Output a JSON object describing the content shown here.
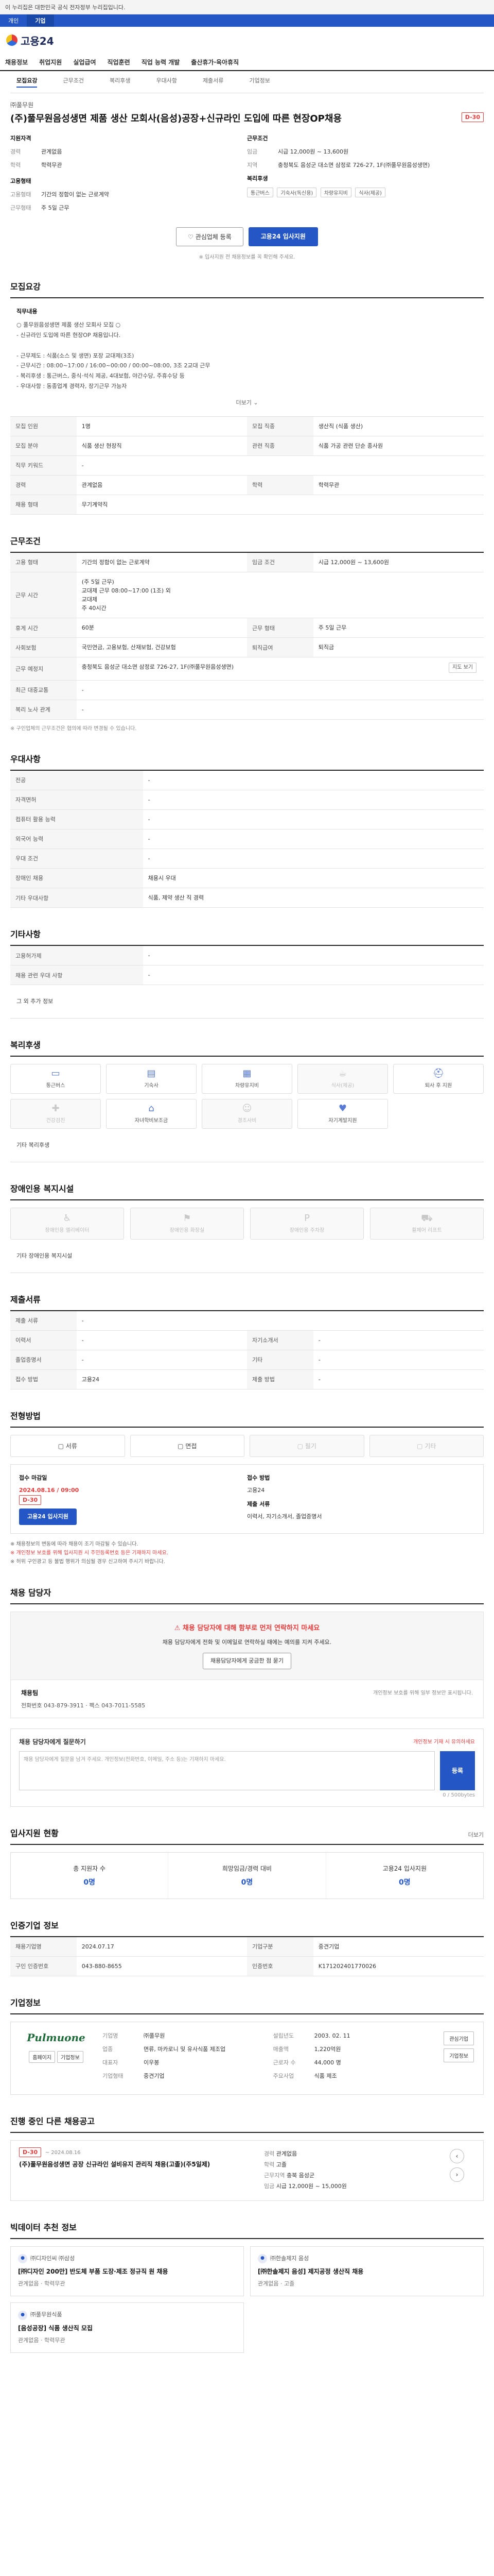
{
  "top_notice": "이 누리집은 대한민국 공식 전자정부 누리집입니다.",
  "bar_tabs": [
    "개인",
    "기업"
  ],
  "logo_text": "고용24",
  "gnb": [
    "채용정보",
    "취업지원",
    "실업급여",
    "직업훈련",
    "직업 능력 개발",
    "출산휴가·육아휴직"
  ],
  "subtabs": [
    "모집요강",
    "근무조건",
    "복리후생",
    "우대사항",
    "제출서류",
    "기업정보"
  ],
  "company": "㈜풀무원",
  "title": "(주)풀무원음성생면 제품 생산 모회사(음성)공장+신규라인 도입에 따른 현장OP채용",
  "dday": "D-30",
  "summary": {
    "left_heading": "지원자격",
    "left": [
      {
        "k": "경력",
        "v": "관계없음"
      },
      {
        "k": "학력",
        "v": "학력무관"
      }
    ],
    "left_heading2": "고용형태",
    "left2": [
      {
        "k": "고용형태",
        "v": "기간의 정함이 없는 근로계약"
      },
      {
        "k": "근무형태",
        "v": "주 5일 근무"
      }
    ],
    "right_heading": "근무조건",
    "right": [
      {
        "k": "임금",
        "v": "시급 12,000원 ~ 13,600원"
      },
      {
        "k": "지역",
        "v": "충청북도 음성군 대소면 삼정로 726-27, 1F(㈜풀무원음성생면)"
      }
    ],
    "right_heading2": "복리후생",
    "chips": [
      "통근버스",
      "기숙사(독신용)",
      "차량유지비",
      "식사(제공)"
    ]
  },
  "actions": {
    "save": "관심업체 등록",
    "apply": "고용24 입사지원"
  },
  "notice_small": "※ 입사지원 전 채용정보를 꼭 확인해 주세요.",
  "sections": {
    "recruit": "모집요강",
    "work": "근무조건",
    "pref": "우대사항",
    "etc": "기타사항",
    "welfare": "복리후생",
    "access": "장애인용 복지시설",
    "docs": "제출서류",
    "process": "전형방법",
    "contact": "채용 담당자",
    "status": "입사지원 현황",
    "info": "인증기업 정보",
    "company": "기업정보",
    "similar": "진행 중인 다른 채용공고",
    "recommend": "빅데이터 추천 정보"
  },
  "job_desc": {
    "heading": "직무내용",
    "text": "○ 풀무원음성생면 제품 생산 모회사 모집 ○\n- 신규라인 도입에 따른 현장OP 채용입니다.\n\n- 근무제도 : 식품(소스 및 생면) 포장 교대제(3조)\n- 근무시간 : 08:00~17:00 / 16:00~00:00 / 00:00~08:00, 3조 2교대 근무\n- 복리후생 : 통근버스, 중식·석식 제공, 4대보험, 야간수당, 주휴수당 등\n- 우대사항 : 동종업계 경력자, 장기근무 가능자",
    "more": "더보기"
  },
  "recruit_rows": [
    [
      "모집 인원",
      "1명",
      "모집 직종",
      "생산직 (식품 생산)"
    ],
    [
      "모집 분야",
      "식품 생산 현장직",
      "관련 직종",
      "식품 가공 관련 단순 종사원"
    ],
    [
      "직무 키워드",
      "-",
      "",
      ""
    ],
    [
      "경력",
      "관계없음",
      "학력",
      "학력무관"
    ],
    [
      "채용 형태",
      "무기계약직",
      "",
      ""
    ]
  ],
  "work_rows": [
    [
      "고용 형태",
      "기간의 정함이 없는 근로계약",
      "임금 조건",
      "시급 12,000원 ~ 13,600원"
    ],
    [
      "근무 시간",
      "(주 5일 근무)\n교대제 근무 08:00~17:00 (1조) 외\n교대제\n주 40시간",
      "",
      ""
    ],
    [
      "휴게 시간",
      "60분",
      "근무 형태",
      "주 5일 근무"
    ],
    [
      "사회보험",
      "국민연금, 고용보험, 산재보험, 건강보험",
      "퇴직급여",
      "퇴직금"
    ],
    [
      "근무 예정지",
      "충청북도 음성군 대소면 삼정로 726-27, 1F(㈜풀무원음성생면)",
      "",
      "지도 보기"
    ],
    [
      "최근 대중교통",
      "-",
      "",
      ""
    ],
    [
      "복리 노사 관계",
      "-",
      "",
      ""
    ]
  ],
  "work_note": "※ 구인업체의 근무조건은 협의에 따라 변경될 수 있습니다.",
  "pref_rows": [
    [
      "전공",
      "-",
      "",
      ""
    ],
    [
      "자격면허",
      "-",
      "",
      ""
    ],
    [
      "컴퓨터 활용 능력",
      "-",
      "",
      ""
    ],
    [
      "외국어 능력",
      "-",
      "",
      ""
    ],
    [
      "우대 조건",
      "-",
      "",
      ""
    ],
    [
      "장애인 채용",
      "채용시 우대",
      "",
      ""
    ],
    [
      "기타 우대사항",
      "식품, 제약 생산 직 경력",
      "",
      ""
    ]
  ],
  "etc_rows": [
    [
      "고용허가제",
      "-"
    ],
    [
      "채용 관련 우대 사항",
      "-"
    ]
  ],
  "etc_extra_heading": "그 외 추가 정보",
  "welfare_items": [
    {
      "icon": "▭",
      "label": "통근버스",
      "on": true
    },
    {
      "icon": "▤",
      "label": "기숙사",
      "on": true
    },
    {
      "icon": "▦",
      "label": "차량유지비",
      "on": true
    },
    {
      "icon": "☕",
      "label": "식사(제공)",
      "on": false
    },
    {
      "icon": "⛑",
      "label": "퇴사 후 지원",
      "on": true
    },
    {
      "icon": "✚",
      "label": "건강검진",
      "on": false
    },
    {
      "icon": "⌂",
      "label": "자녀학비보조금",
      "on": true
    },
    {
      "icon": "☺",
      "label": "경조사비",
      "on": false
    },
    {
      "icon": "♥",
      "label": "자기계발지원",
      "on": true
    }
  ],
  "welfare_extra_label": "기타 복리후생",
  "access_items": [
    {
      "icon": "♿",
      "label": "장애인용 엘리베이터",
      "on": false
    },
    {
      "icon": "⚑",
      "label": "장애인용 화장실",
      "on": false
    },
    {
      "icon": "P",
      "label": "장애인용 주차장",
      "on": false
    },
    {
      "icon": "⛟",
      "label": "휠체어 리프트",
      "on": false
    }
  ],
  "access_extra_label": "기타 장애인용 복지시설",
  "doc_rows": [
    [
      "제출 서류",
      "-",
      "",
      ""
    ],
    [
      "이력서",
      "-",
      "자기소개서",
      "-"
    ],
    [
      "졸업증명서",
      "-",
      "기타",
      "-"
    ],
    [
      "접수 방법",
      "고용24",
      "제출 방법",
      "-"
    ]
  ],
  "process_items": [
    {
      "label": "서류",
      "on": true
    },
    {
      "label": "면접",
      "on": true
    },
    {
      "label": "필기",
      "on": false
    },
    {
      "label": "기타",
      "on": false
    }
  ],
  "apply": {
    "date_label": "접수 마감일",
    "date": "2024.08.16 / 09:00",
    "dday": "D-30",
    "btn": "고용24 입사지원",
    "method_label": "접수 방법",
    "method": "고용24",
    "form_label": "제출 서류",
    "form": "이력서, 자기소개서, 졸업증명서"
  },
  "warn": [
    "※ 채용정보의 변동에 따라 채용이 조기 마감될 수 있습니다.",
    "※ 개인정보 보호를 위해 입사지원 시 주민등록번호 등은 기재하지 마세요.",
    "※ 허위 구인광고 등 불법 행위가 의심될 경우 신고하여 주시기 바랍니다."
  ],
  "contact": {
    "alert_title": "채용 담당자에 대해 함부로 먼저 연락하지 마세요",
    "alert_text": "채용 담당자에게 전화 및 이메일로 연락하실 때에는 예의를 지켜 주세요.",
    "alert_btn": "채용담당자에게 궁금한 점 묻기",
    "name": "채용팀",
    "phone_label": "전화번호",
    "phone": "043-879-3911",
    "fax_label": "팩스",
    "fax": "043-7011-5585",
    "right_note": "개인정보 보호를 위해 일부 정보만 표시됩니다."
  },
  "question": {
    "title": "채용 담당자에게 질문하기",
    "priv": "개인정보 기재 시 유의하세요",
    "placeholder": "채용 담당자에게 질문을 남겨 주세요. 개인정보(전화번호, 이메일, 주소 등)는 기재하지 마세요.",
    "counter": "0 / 500bytes",
    "send": "등록"
  },
  "status": [
    {
      "label": "총 지원자 수",
      "value": "0명"
    },
    {
      "label": "희망임금/경력 대비",
      "value": "0명"
    },
    {
      "label": "고용24 입사지원",
      "value": "0명"
    }
  ],
  "status_more": "더보기",
  "info_rows": [
    [
      "채용기업명",
      "2024.07.17",
      "기업구분",
      "중견기업"
    ],
    [
      "구인 인증번호",
      "043-880-8655",
      "인증번호",
      "K171202401770026"
    ]
  ],
  "company_info": {
    "brand": "Pulmuone",
    "logo_btns": [
      "홈페이지",
      "기업정보"
    ],
    "left": [
      {
        "k": "기업명",
        "v": "㈜풀무원"
      },
      {
        "k": "업종",
        "v": "면류, 마카로니 및 유사식품 제조업"
      },
      {
        "k": "대표자",
        "v": "이우봉"
      },
      {
        "k": "기업형태",
        "v": "중견기업"
      }
    ],
    "right": [
      {
        "k": "설립년도",
        "v": "2003. 02. 11"
      },
      {
        "k": "매출액",
        "v": "1,220억원"
      },
      {
        "k": "근로자 수",
        "v": "44,000 명"
      },
      {
        "k": "주요사업",
        "v": "식품 제조"
      }
    ],
    "btns": [
      "관심기업",
      "기업정보"
    ]
  },
  "similar": {
    "dday": "D-30",
    "period": "~ 2024.08.16",
    "title": "(주)풀무원음성생면 공장 신규라인 설비유지 관리직 채용(고졸)(주5일제)",
    "meta": [
      {
        "k": "경력",
        "v": "관계없음"
      },
      {
        "k": "학력",
        "v": "고졸"
      },
      {
        "k": "근무지역",
        "v": "충북 음성군"
      },
      {
        "k": "임금",
        "v": "시급 12,000원 ~ 15,000원"
      }
    ]
  },
  "recommend": [
    {
      "company": "㈜디자인씨 ㈜삼성",
      "title": "[㈜디자인 200만] 반도체 부품 도장·제조 정규직 원 채용",
      "meta": "관계없음 · 학력무관"
    },
    {
      "company": "㈜한솔제지 음성",
      "title": "[㈜한솔제지 음성] 제지공정 생산직 채용",
      "meta": "관계없음 · 고졸"
    },
    {
      "company": "㈜풀무원식품",
      "title": "[음성공장] 식품 생산직 모집",
      "meta": "관계없음 · 학력무관"
    },
    {
      "company": "",
      "title": "",
      "meta": ""
    }
  ],
  "colors": {
    "primary": "#2457c5",
    "danger": "#e53c3c"
  }
}
